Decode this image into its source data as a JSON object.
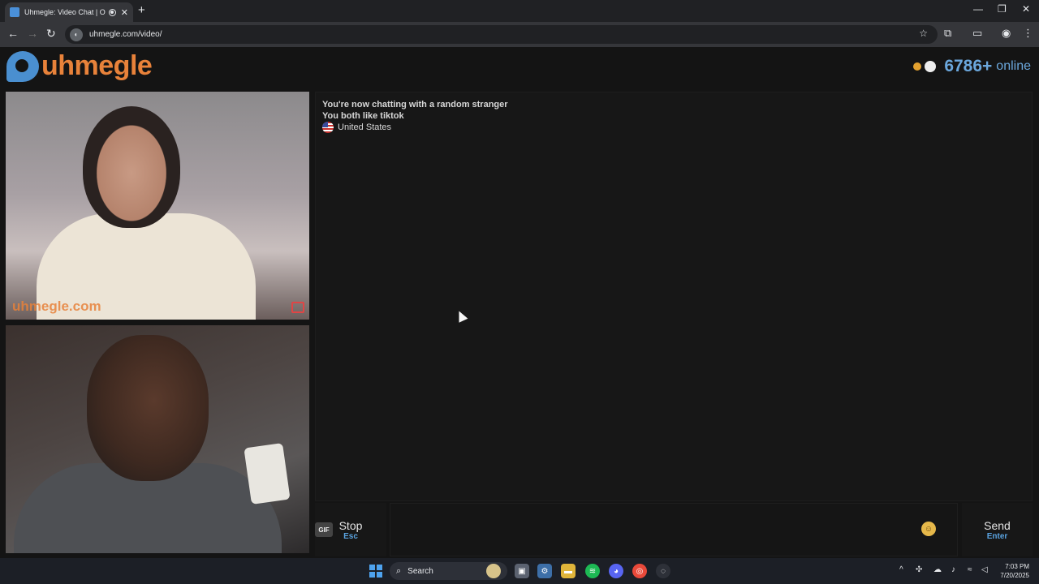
{
  "browser": {
    "tab_title": "Uhmegle: Video Chat | Omegle",
    "new_tab_symbol": "+",
    "url": "uhmegle.com/video/",
    "window_controls": {
      "minimize": "—",
      "restore": "❐",
      "close": "✕"
    }
  },
  "site": {
    "logo_text": "uhmegle",
    "online_count": "6786+",
    "online_label": "online"
  },
  "videos": {
    "stranger_watermark": "uhmegle.com"
  },
  "chat": {
    "lines": [
      "You're now chatting with a random stranger",
      "You both like tiktok"
    ],
    "country": "United States"
  },
  "controls": {
    "stop_label": "Stop",
    "stop_hint": "Esc",
    "gif_label": "GIF",
    "send_label": "Send",
    "send_hint": "Enter"
  },
  "taskbar": {
    "search_label": "Search",
    "time": "7:03 PM",
    "date": "7/20/2025"
  },
  "colors": {
    "brand_orange": "#e8823a",
    "brand_blue": "#4a8fd0",
    "hint_blue": "#5aa3e0",
    "background": "#141414"
  }
}
